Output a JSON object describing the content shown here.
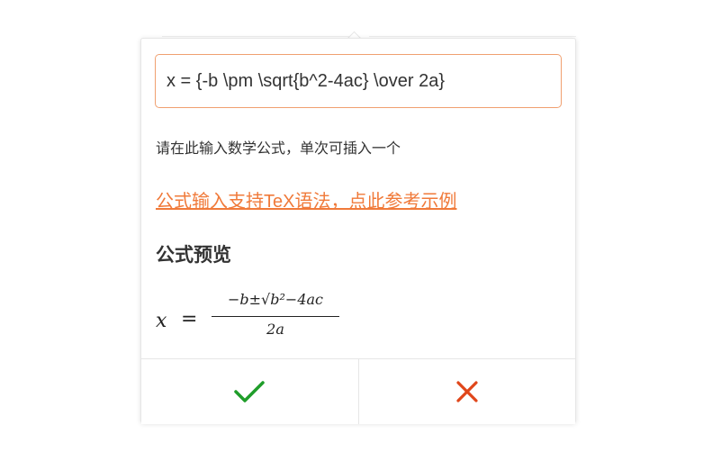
{
  "formula_input": {
    "value": "x = {-b \\pm \\sqrt{b^2-4ac} \\over 2a}"
  },
  "hint_text": "请在此输入数学公式，单次可插入一个",
  "tex_link_text": "公式输入支持TeX语法，点此参考示例",
  "preview": {
    "title": "公式预览",
    "lhs": "x",
    "equals": "=",
    "numerator": "−b±√b²−4ac",
    "denominator": "2a"
  },
  "buttons": {
    "confirm_icon": "check-icon",
    "cancel_icon": "close-icon"
  },
  "colors": {
    "accent": "#f07a3a",
    "input_border": "#f0a070",
    "confirm": "#1f9d2a",
    "cancel": "#e0461a"
  }
}
